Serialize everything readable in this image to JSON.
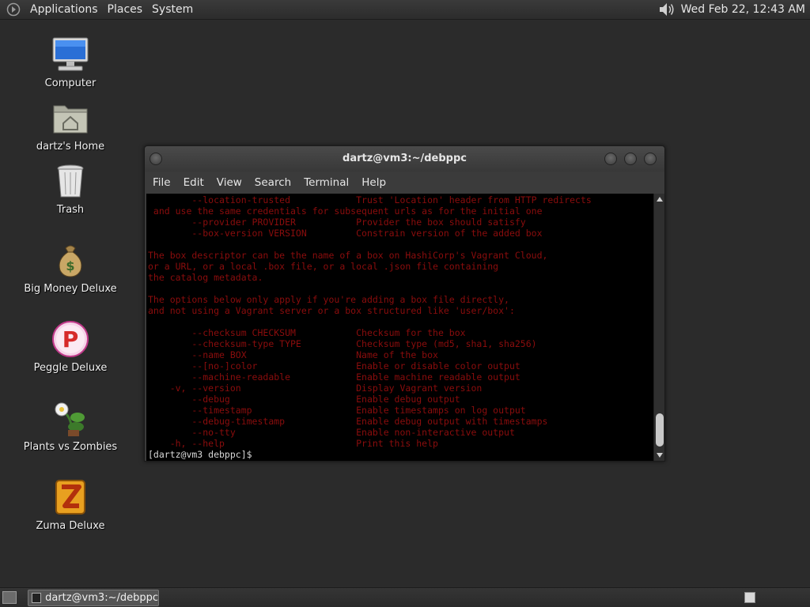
{
  "top_panel": {
    "menus": [
      "Applications",
      "Places",
      "System"
    ],
    "clock": "Wed Feb 22, 12:43 AM",
    "volume_icon": "speaker-icon"
  },
  "desktop_icons": [
    {
      "label": "Computer",
      "icon": "computer-icon"
    },
    {
      "label": "dartz's Home",
      "icon": "home-folder-icon"
    },
    {
      "label": "Trash",
      "icon": "trash-icon"
    },
    {
      "label": "Big Money Deluxe",
      "icon": "money-bag-icon"
    },
    {
      "label": "Peggle Deluxe",
      "icon": "peggle-icon"
    },
    {
      "label": "Plants vs Zombies",
      "icon": "plant-icon"
    },
    {
      "label": "Zuma Deluxe",
      "icon": "zuma-icon"
    }
  ],
  "terminal": {
    "title": "dartz@vm3:~/debppc",
    "menus": [
      "File",
      "Edit",
      "View",
      "Search",
      "Terminal",
      "Help"
    ],
    "lines": [
      "        --location-trusted            Trust 'Location' header from HTTP redirects",
      " and use the same credentials for subsequent urls as for the initial one",
      "        --provider PROVIDER           Provider the box should satisfy",
      "        --box-version VERSION         Constrain version of the added box",
      "",
      "The box descriptor can be the name of a box on HashiCorp's Vagrant Cloud,",
      "or a URL, or a local .box file, or a local .json file containing",
      "the catalog metadata.",
      "",
      "The options below only apply if you're adding a box file directly,",
      "and not using a Vagrant server or a box structured like 'user/box':",
      "",
      "        --checksum CHECKSUM           Checksum for the box",
      "        --checksum-type TYPE          Checksum type (md5, sha1, sha256)",
      "        --name BOX                    Name of the box",
      "        --[no-]color                  Enable or disable color output",
      "        --machine-readable            Enable machine readable output",
      "    -v, --version                     Display Vagrant version",
      "        --debug                       Enable debug output",
      "        --timestamp                   Enable timestamps on log output",
      "        --debug-timestamp             Enable debug output with timestamps",
      "        --no-tty                      Enable non-interactive output",
      "    -h, --help                        Print this help"
    ],
    "prompt": "[dartz@vm3 debppc]$ "
  },
  "bottom_panel": {
    "task_label": "dartz@vm3:~/debppc"
  },
  "colors": {
    "terminal_text": "#8b0d0d",
    "desktop_bg": "#2b2b2b",
    "terminal_bg": "#000000"
  }
}
